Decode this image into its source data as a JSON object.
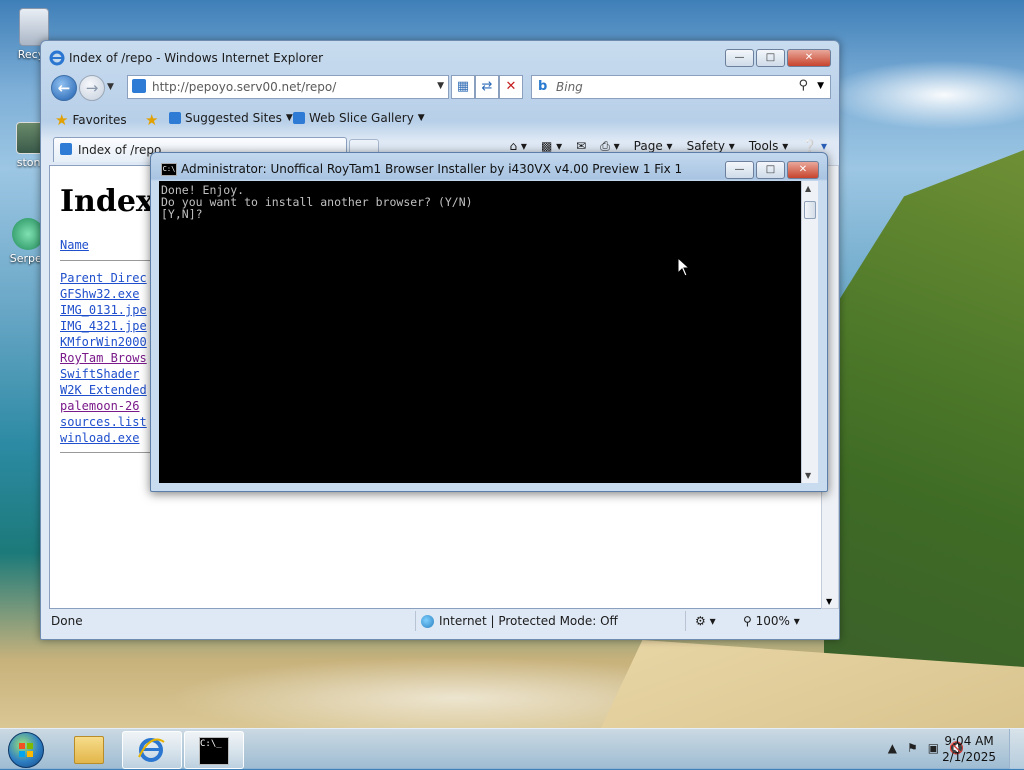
{
  "desktop": {
    "icons": [
      {
        "label": "Recyc"
      },
      {
        "label": "stone"
      },
      {
        "label": "Serper"
      }
    ]
  },
  "ie": {
    "window_title": "Index of /repo - Windows Internet Explorer",
    "address": "http://pepoyo.serv00.net/repo/",
    "search_placeholder": "Bing",
    "favorites_label": "Favorites",
    "suggested_sites": "Suggested Sites",
    "web_slice_gallery": "Web Slice Gallery",
    "tab_label": "Index of /repo",
    "commands": {
      "page": "Page",
      "safety": "Safety",
      "tools": "Tools"
    },
    "page": {
      "heading": "Index o",
      "column_name": "Name",
      "files": [
        {
          "name": "Parent Direc",
          "visited": false
        },
        {
          "name": "GFShw32.exe",
          "visited": false
        },
        {
          "name": "IMG_0131.jpe",
          "visited": false
        },
        {
          "name": "IMG_4321.jpe",
          "visited": false
        },
        {
          "name": "KMforWin2000",
          "visited": false
        },
        {
          "name": "RoyTam Brows",
          "visited": true
        },
        {
          "name": "SwiftShader",
          "visited": false
        },
        {
          "name": "W2K Extended",
          "visited": false
        },
        {
          "name": "palemoon-26",
          "visited": true
        },
        {
          "name": "sources.list",
          "visited": false
        },
        {
          "name": "winload.exe",
          "visited": false
        }
      ]
    },
    "status": {
      "left": "Done",
      "zone": "Internet | Protected Mode: Off",
      "zoom": "100%"
    }
  },
  "console": {
    "title": "Administrator:  Unoffical RoyTam1 Browser Installer by i430VX v4.00 Preview 1 Fix 1",
    "lines": [
      "Done! Enjoy.",
      "Do you want to install another browser? (Y/N)",
      "[Y,N]?"
    ]
  },
  "taskbar": {
    "time": "9:04 AM",
    "date": "2/1/2025"
  },
  "colors": {
    "link": "#1f4fcc",
    "visited": "#7a1a8a",
    "console_bg": "#000000",
    "console_fg": "#c0c0c0"
  }
}
